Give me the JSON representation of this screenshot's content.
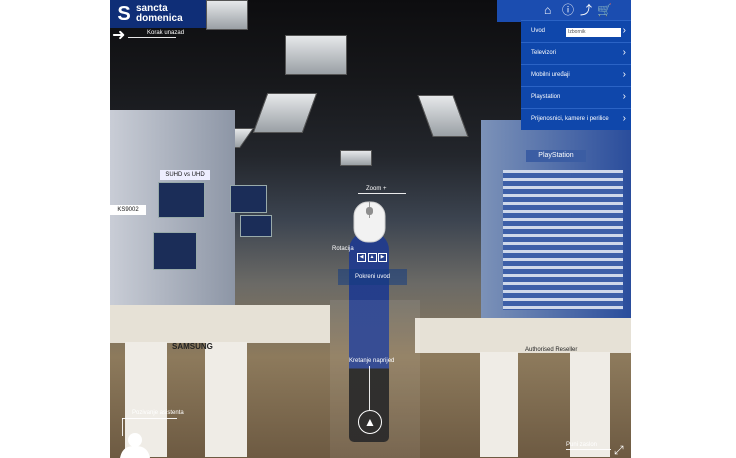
{
  "brand": {
    "logo_text_1": "sancta",
    "logo_text_2": "domenica"
  },
  "controls": {
    "back_label": "Korak unazad",
    "zoom_label": "Zoom +",
    "rotate_label": "Rotacija",
    "start_button": "Pokreni uvod",
    "forward_label": "Kretanje naprijed",
    "assistant_label": "Pozivanje asistenta",
    "fullscreen_label": "Puni zaslon"
  },
  "topbar": {
    "close_icon": "close-icon",
    "home_icon": "home-icon",
    "info_icon": "info-icon",
    "share_icon": "share-icon",
    "cart_icon": "cart-icon"
  },
  "menu": {
    "dropdown_value": "Izbornik",
    "items": [
      {
        "label": "Uvod"
      },
      {
        "label": "Televizori"
      },
      {
        "label": "Mobilni uređaji"
      },
      {
        "label": "Playstation"
      },
      {
        "label": "Prijenosnici, kamere i perilice"
      }
    ]
  },
  "scene": {
    "brand_left": "SAMSUNG",
    "brand_right": "Authorised Reseller",
    "sign_left": "SUHD vs UHD",
    "sign_left_2": "KS9002",
    "sign_right": "PlayStation"
  }
}
